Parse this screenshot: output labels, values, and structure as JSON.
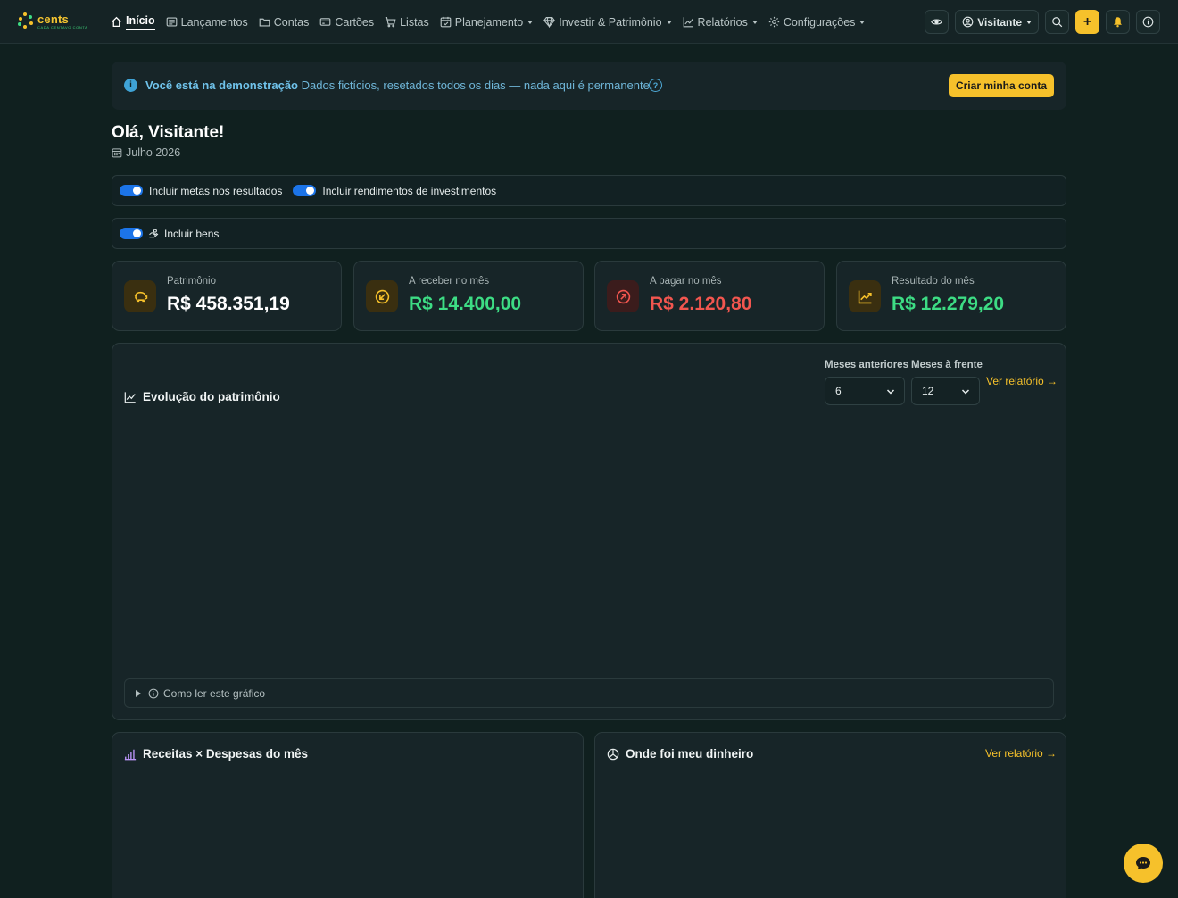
{
  "brand": {
    "name": "cents",
    "tagline": "CADA CENTAVO CONTA"
  },
  "nav": {
    "items": [
      {
        "label": "Início",
        "icon": "home-icon",
        "active": true,
        "dropdown": false
      },
      {
        "label": "Lançamentos",
        "icon": "list-icon",
        "active": false,
        "dropdown": false
      },
      {
        "label": "Contas",
        "icon": "folder-icon",
        "active": false,
        "dropdown": false
      },
      {
        "label": "Cartões",
        "icon": "card-icon",
        "active": false,
        "dropdown": false
      },
      {
        "label": "Listas",
        "icon": "cart-icon",
        "active": false,
        "dropdown": false
      },
      {
        "label": "Planejamento",
        "icon": "calendar-check-icon",
        "active": false,
        "dropdown": true
      },
      {
        "label": "Investir & Patrimônio",
        "icon": "gem-icon",
        "active": false,
        "dropdown": true
      },
      {
        "label": "Relatórios",
        "icon": "chart-line-icon",
        "active": false,
        "dropdown": true
      },
      {
        "label": "Configurações",
        "icon": "gear-icon",
        "active": false,
        "dropdown": true
      }
    ],
    "user_label": "Visitante",
    "add_label": "+"
  },
  "banner": {
    "title": "Você está na demonstração",
    "text": "Dados fictícios, resetados todos os dias — nada aqui é permanente.",
    "cta": "Criar minha conta"
  },
  "greeting": "Olá, Visitante!",
  "month": "Julho 2026",
  "toggles": {
    "metas": "Incluir metas nos resultados",
    "rendimentos": "Incluir rendimentos de investimentos",
    "bens": "Incluir bens"
  },
  "stats": [
    {
      "label": "Patrimônio",
      "value": "R$ 458.351,19",
      "color": "#ffffff",
      "icon": "piggy-bank-icon",
      "icon_bg": "#3a2f10",
      "icon_color": "#f6c12b"
    },
    {
      "label": "A receber no mês",
      "value": "R$ 14.400,00",
      "color": "#3ddc84",
      "icon": "arrow-down-left-icon",
      "icon_bg": "#3a2f10",
      "icon_color": "#f6c12b"
    },
    {
      "label": "A pagar no mês",
      "value": "R$ 2.120,80",
      "color": "#f2564f",
      "icon": "arrow-up-right-icon",
      "icon_bg": "#3b1c1c",
      "icon_color": "#f2564f"
    },
    {
      "label": "Resultado do mês",
      "value": "R$ 12.279,20",
      "color": "#3ddc84",
      "icon": "trend-up-icon",
      "icon_bg": "#3a2f10",
      "icon_color": "#f6c12b"
    }
  ],
  "evolution": {
    "title": "Evolução do patrimônio",
    "prev_label": "Meses anteriores",
    "prev_value": "6",
    "next_label": "Meses à frente",
    "next_value": "12",
    "report_link": "Ver relatório →",
    "help": "Como ler este gráfico"
  },
  "income_expense": {
    "title": "Receitas × Despesas do mês"
  },
  "where_money": {
    "title": "Onde foi meu dinheiro",
    "report_link": "Ver relatório →"
  }
}
